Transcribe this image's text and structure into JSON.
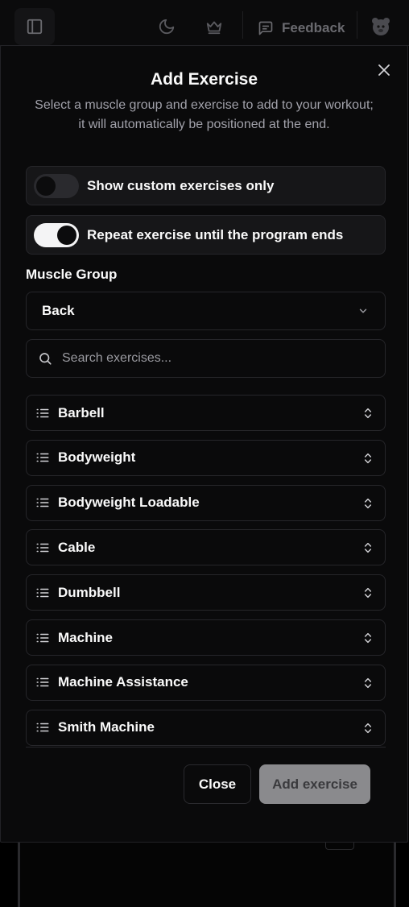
{
  "header": {
    "feedback_label": "Feedback",
    "icons": [
      "sidebar-toggle-icon",
      "moon-icon",
      "crown-icon",
      "message-square-icon",
      "avatar"
    ]
  },
  "dialog": {
    "title": "Add Exercise",
    "subtitle": "Select a muscle group and exercise to add to your workout; it will automatically be positioned at the end.",
    "toggles": {
      "custom_only": {
        "label": "Show custom exercises only",
        "checked": false
      },
      "repeat": {
        "label": "Repeat exercise until the program ends",
        "checked": true
      }
    },
    "muscle_group": {
      "label": "Muscle Group",
      "value": "Back"
    },
    "search": {
      "placeholder": "Search exercises..."
    },
    "categories": [
      "Barbell",
      "Bodyweight",
      "Bodyweight Loadable",
      "Cable",
      "Dumbbell",
      "Machine",
      "Machine Assistance",
      "Smith Machine"
    ],
    "buttons": {
      "close": "Close",
      "add": "Add exercise"
    }
  },
  "colors": {
    "background": "#0a0a0b",
    "border": "#26262a",
    "muted_text": "#a1a1aa",
    "disabled_button": "#8a8a8d"
  }
}
